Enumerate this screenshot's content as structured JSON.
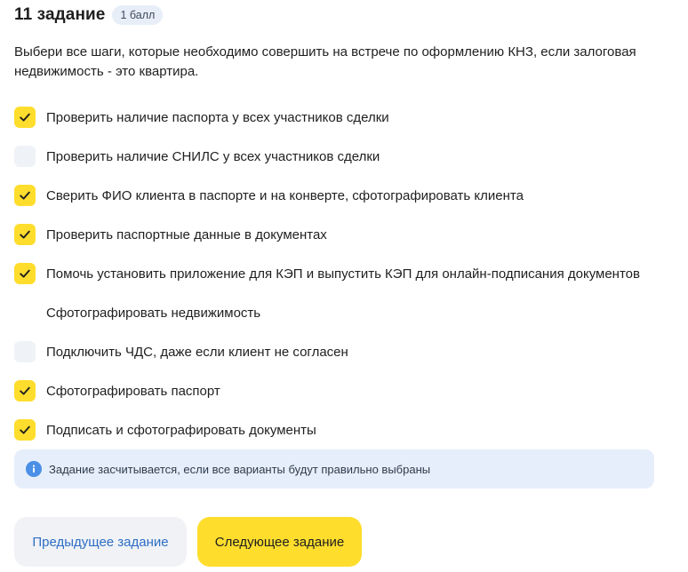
{
  "task": {
    "title": "11 задание",
    "score_badge": "1 балл",
    "question": "Выбери все шаги, которые необходимо совершить на встрече по оформлению КНЗ, если залоговая недвижимость - это квартира."
  },
  "options": [
    {
      "label": "Проверить наличие паспорта у всех участников сделки",
      "state": "checked"
    },
    {
      "label": "Проверить наличие СНИЛС у всех участников сделки",
      "state": "unchecked"
    },
    {
      "label": "Сверить ФИО клиента в паспорте и на конверте, сфотографировать клиента",
      "state": "checked"
    },
    {
      "label": "Проверить паспортные данные в документах",
      "state": "checked"
    },
    {
      "label": "Помочь установить приложение для КЭП и выпустить КЭП для онлайн-подписания документов",
      "state": "checked"
    },
    {
      "label": "Сфотографировать недвижимость",
      "state": "blank"
    },
    {
      "label": "Подключить ЧДС, даже если клиент не согласен",
      "state": "unchecked"
    },
    {
      "label": "Сфотографировать паспорт",
      "state": "checked"
    },
    {
      "label": "Подписать и сфотографировать документы",
      "state": "checked"
    }
  ],
  "info": {
    "text": "Задание засчитывается, если все варианты будут правильно выбраны",
    "icon": "info-icon"
  },
  "buttons": {
    "prev_label": "Предыдущее задание",
    "next_label": "Следующее задание"
  },
  "colors": {
    "accent_yellow": "#ffdd2d",
    "link_blue": "#2e6ec6",
    "info_bg": "#e6eefb",
    "unchecked_bg": "#eff2f6"
  }
}
